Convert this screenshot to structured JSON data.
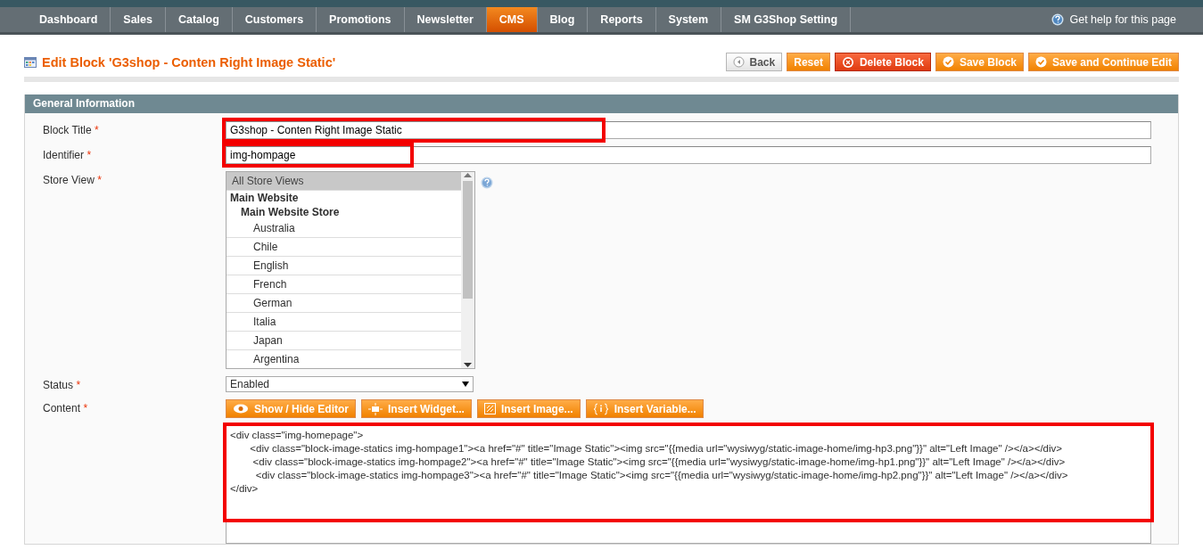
{
  "nav": {
    "items": [
      {
        "label": "Dashboard",
        "selected": false
      },
      {
        "label": "Sales",
        "selected": false
      },
      {
        "label": "Catalog",
        "selected": false
      },
      {
        "label": "Customers",
        "selected": false
      },
      {
        "label": "Promotions",
        "selected": false
      },
      {
        "label": "Newsletter",
        "selected": false
      },
      {
        "label": "CMS",
        "selected": true
      },
      {
        "label": "Blog",
        "selected": false
      },
      {
        "label": "Reports",
        "selected": false
      },
      {
        "label": "System",
        "selected": false
      },
      {
        "label": "SM G3Shop Setting",
        "selected": false
      }
    ],
    "help": "Get help for this page"
  },
  "page_title": "Edit Block 'G3shop - Conten Right Image Static'",
  "actions": [
    {
      "label": "Back",
      "kind": "back"
    },
    {
      "label": "Reset",
      "kind": "plain"
    },
    {
      "label": "Delete Block",
      "kind": "delete"
    },
    {
      "label": "Save Block",
      "kind": "save"
    },
    {
      "label": "Save and Continue Edit",
      "kind": "save"
    }
  ],
  "section_title": "General Information",
  "block_title": {
    "label": "Block Title",
    "mark": "*",
    "value": "G3shop - Conten Right Image Static",
    "highlighted": true
  },
  "identifier": {
    "label": "Identifier",
    "mark": "*",
    "value": "img-hompage",
    "highlighted": true
  },
  "store_view": {
    "label": "Store View",
    "mark": "*",
    "options": [
      {
        "label": "All Store Views",
        "selected": true
      },
      {
        "label": "Main Website",
        "selected": false,
        "children": [
          {
            "label": "Main Website Store",
            "selected": false,
            "children": [
              {
                "label": "Australia",
                "selected": false
              },
              {
                "label": "Chile",
                "selected": false
              },
              {
                "label": "English",
                "selected": false
              },
              {
                "label": "French",
                "selected": false
              },
              {
                "label": "German",
                "selected": false
              },
              {
                "label": "Italia",
                "selected": false
              },
              {
                "label": "Japan",
                "selected": false
              },
              {
                "label": "Argentina",
                "selected": false
              }
            ]
          }
        ]
      }
    ]
  },
  "status": {
    "label": "Status",
    "mark": "*",
    "value": "Enabled"
  },
  "content": {
    "label": "Content",
    "mark": "*",
    "highlighted": true,
    "editor_buttons": [
      {
        "label": "Show / Hide Editor",
        "kind": "eye"
      },
      {
        "label": "Insert Widget...",
        "kind": "widget"
      },
      {
        "label": "Insert Image...",
        "kind": "image"
      },
      {
        "label": "Insert Variable...",
        "kind": "variable"
      }
    ],
    "lines": [
      "<div class=\"img-homepage\">",
      "       <div class=\"block-image-statics img-hompage1\"><a href=\"#\" title=\"Image Static\"><img src=\"{{media url=\"wysiwyg/static-image-home/img-hp3.png\"}}\" alt=\"Left Image\" /></a></div>",
      "        <div class=\"block-image-statics img-hompage2\"><a href=\"#\" title=\"Image Static\"><img src=\"{{media url=\"wysiwyg/static-image-home/img-hp1.png\"}}\" alt=\"Left Image\" /></a></div>",
      "         <div class=\"block-image-statics img-hompage3\"><a href=\"#\" title=\"Image Static\"><img src=\"{{media url=\"wysiwyg/static-image-home/img-hp2.png\"}}\" alt=\"Left Image\" /></a></div>",
      "</div>"
    ]
  }
}
